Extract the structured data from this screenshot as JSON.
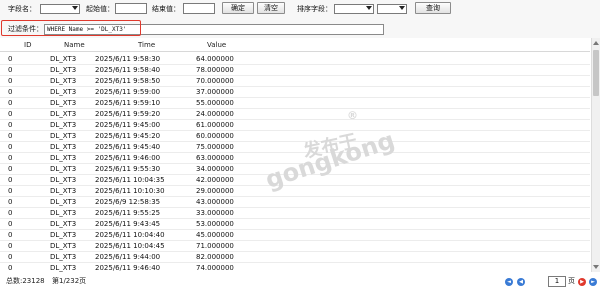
{
  "toolbar": {
    "field_label": "字段名：",
    "start_label": "起始值：",
    "end_label": "结束值：",
    "confirm_button": "确定",
    "clear_button": "清空",
    "sort_label": "排序字段：",
    "query_button": "查询",
    "filter_label": "过滤条件：",
    "filter_value": "WHERE Name >= 'DL_XT3'"
  },
  "grid": {
    "columns": [
      "ID",
      "Name",
      "Time",
      "Value"
    ],
    "rows": [
      [
        "0",
        "DL_XT3",
        "2025/6/11 9:58:30",
        "64.000000"
      ],
      [
        "0",
        "DL_XT3",
        "2025/6/11 9:58:40",
        "78.000000"
      ],
      [
        "0",
        "DL_XT3",
        "2025/6/11 9:58:50",
        "70.000000"
      ],
      [
        "0",
        "DL_XT3",
        "2025/6/11 9:59:00",
        "37.000000"
      ],
      [
        "0",
        "DL_XT3",
        "2025/6/11 9:59:10",
        "55.000000"
      ],
      [
        "0",
        "DL_XT3",
        "2025/6/11 9:59:20",
        "24.000000"
      ],
      [
        "0",
        "DL_XT3",
        "2025/6/11 9:45:00",
        "61.000000"
      ],
      [
        "0",
        "DL_XT3",
        "2025/6/11 9:45:20",
        "60.000000"
      ],
      [
        "0",
        "DL_XT3",
        "2025/6/11 9:45:40",
        "75.000000"
      ],
      [
        "0",
        "DL_XT3",
        "2025/6/11 9:46:00",
        "63.000000"
      ],
      [
        "0",
        "DL_XT3",
        "2025/6/11 9:55:30",
        "34.000000"
      ],
      [
        "0",
        "DL_XT3",
        "2025/6/11 10:04:35",
        "42.000000"
      ],
      [
        "0",
        "DL_XT3",
        "2025/6/11 10:10:30",
        "29.000000"
      ],
      [
        "0",
        "DL_XT3",
        "2025/6/9 12:58:35",
        "43.000000"
      ],
      [
        "0",
        "DL_XT3",
        "2025/6/11 9:55:25",
        "33.000000"
      ],
      [
        "0",
        "DL_XT3",
        "2025/6/11 9:43:45",
        "53.000000"
      ],
      [
        "0",
        "DL_XT3",
        "2025/6/11 10:04:40",
        "45.000000"
      ],
      [
        "0",
        "DL_XT3",
        "2025/6/11 10:04:45",
        "71.000000"
      ],
      [
        "0",
        "DL_XT3",
        "2025/6/11 9:44:00",
        "82.000000"
      ],
      [
        "0",
        "DL_XT3",
        "2025/6/11 9:46:40",
        "74.000000"
      ],
      [
        "0",
        "DL_XT3",
        "2025/6/11 10:04:55",
        "16.000000"
      ]
    ]
  },
  "status": {
    "total": "总数:23128",
    "page_info": "第1/232页",
    "current_page": "1",
    "page_suffix": "页"
  },
  "watermark": {
    "line1": "发布于",
    "line2": "gongkong",
    "mark": "®"
  }
}
